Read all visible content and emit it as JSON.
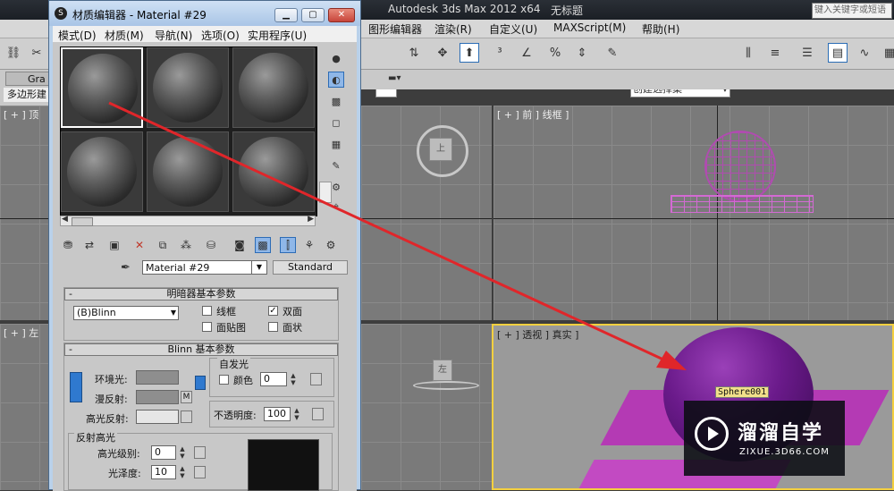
{
  "max_window": {
    "title": "Autodesk 3ds Max  2012 x64",
    "doc_title": "无标题",
    "search_placeholder": "键入关键字或短语"
  },
  "max_menu": [
    "图形编辑器",
    "渲染(R)",
    "自定义(U)",
    "MAXScript(M)",
    "帮助(H)"
  ],
  "selection_set": "创建选择集",
  "ribbon": {
    "tab": "Gra",
    "sub": "多边形建"
  },
  "viewports": {
    "top": "[ + ] 顶",
    "front": "[ + ] 前 ] 线框 ]",
    "left": "[ + ] 左",
    "perspective": "[ + ] 透视 ] 真实 ]"
  },
  "gizmo_labels": {
    "top": "上",
    "left": "左"
  },
  "object_tag": "Sphere001",
  "material_editor": {
    "title": "材质编辑器 - Material #29",
    "menu": [
      "模式(D)",
      "材质(M)",
      "导航(N)",
      "选项(O)",
      "实用程序(U)"
    ],
    "material_name": "Material #29",
    "material_type": "Standard",
    "shader_rollout": {
      "title": "明暗器基本参数",
      "shader": "(B)Blinn",
      "options": [
        {
          "label": "线框",
          "checked": false
        },
        {
          "label": "双面",
          "checked": true
        },
        {
          "label": "面贴图",
          "checked": false
        },
        {
          "label": "面状",
          "checked": false
        }
      ]
    },
    "blinn_rollout": {
      "title": "Blinn 基本参数",
      "self_illum_group": "自发光",
      "ambient": "环境光:",
      "diffuse": "漫反射:",
      "specular": "高光反射:",
      "color_label": "颜色",
      "self_illum_value": "0",
      "opacity_label": "不透明度:",
      "opacity_value": "100",
      "map_button": "M"
    },
    "specular_group": {
      "title": "反射高光",
      "level_label": "高光级别:",
      "level_value": "0",
      "gloss_label": "光泽度:",
      "gloss_value": "10"
    }
  },
  "watermark": {
    "cn": "溜溜自学",
    "en": "ZIXUE.3D66.COM"
  },
  "colors": {
    "arrow": "#e0262a",
    "accent": "#2a6db5",
    "object_purple": "#6a1a8a"
  }
}
